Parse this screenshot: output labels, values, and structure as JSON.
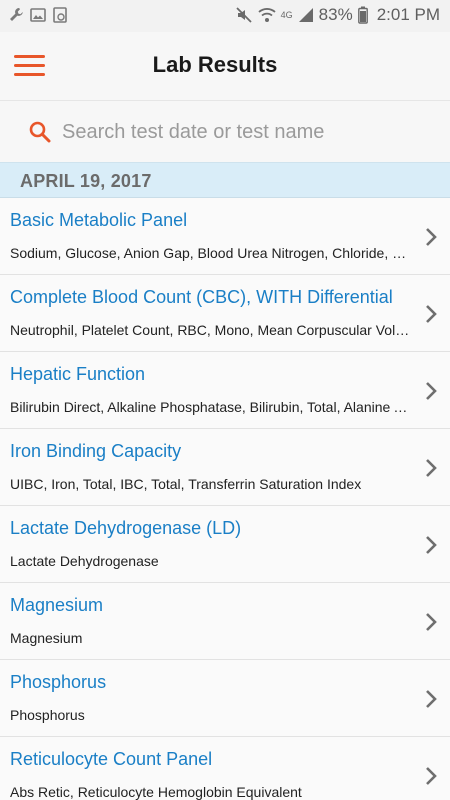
{
  "status_bar": {
    "left_icons": [
      "wrench-icon",
      "image-icon",
      "sync-icon"
    ],
    "network": "4G",
    "battery": "83%",
    "time": "2:01 PM"
  },
  "header": {
    "title": "Lab Results",
    "menu_icon": "hamburger-menu-icon"
  },
  "search": {
    "placeholder": "Search test date or test name",
    "value": ""
  },
  "section": {
    "date": "APRIL 19, 2017"
  },
  "results": [
    {
      "title": "Basic Metabolic Panel",
      "subtitle": "Sodium, Glucose, Anion Gap, Blood Urea Nitrogen, Chloride, Creatinine"
    },
    {
      "title": "Complete Blood Count (CBC), WITH Differential",
      "subtitle": "Neutrophil, Platelet Count, RBC, Mono, Mean Corpuscular Volume"
    },
    {
      "title": "Hepatic Function",
      "subtitle": "Bilirubin Direct, Alkaline Phosphatase, Bilirubin, Total, Alanine Aminotransferase"
    },
    {
      "title": "Iron Binding Capacity",
      "subtitle": "UIBC, Iron, Total, IBC, Total, Transferrin Saturation Index"
    },
    {
      "title": "Lactate Dehydrogenase (LD)",
      "subtitle": "Lactate Dehydrogenase"
    },
    {
      "title": "Magnesium",
      "subtitle": "Magnesium"
    },
    {
      "title": "Phosphorus",
      "subtitle": "Phosphorus"
    },
    {
      "title": "Reticulocyte Count Panel",
      "subtitle": "Abs Retic, Reticulocyte Hemoglobin Equivalent"
    }
  ],
  "colors": {
    "accent": "#e8562a",
    "link": "#1a7fc6",
    "section_bg": "#d9edf8"
  }
}
